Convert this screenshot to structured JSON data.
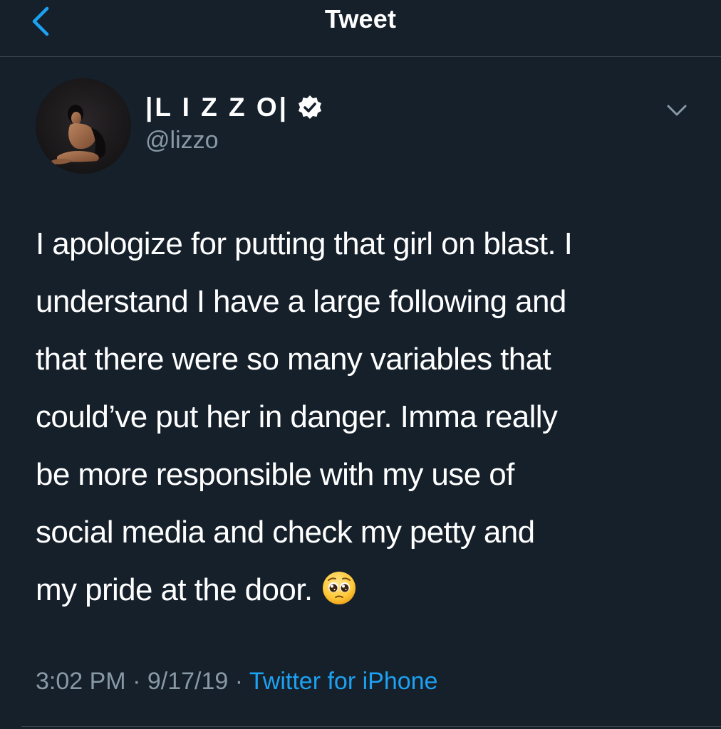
{
  "header": {
    "back_icon": "chevron-left-icon",
    "title": "Tweet"
  },
  "author": {
    "display_name": "|L I Z Z O|",
    "verified_icon": "verified-badge-icon",
    "handle": "@lizzo"
  },
  "menu_icon": "chevron-down-icon",
  "tweet": {
    "lines": [
      "I apologize for putting that girl on blast. I",
      "understand I have a large following and",
      "that there were so many variables that",
      "could’ve put her in danger. Imma really",
      "be more responsible with my use of",
      "social media and check my petty and",
      "my pride at the door."
    ],
    "emoji": "pleading-face-emoji"
  },
  "meta": {
    "time": "3:02 PM",
    "separator": " · ",
    "date": "9/17/19",
    "source": "Twitter for iPhone"
  },
  "colors": {
    "background": "#15202b",
    "divider": "#38444d",
    "accent": "#1da1f2",
    "secondary_text": "#8899a6",
    "primary_text": "#ffffff"
  }
}
